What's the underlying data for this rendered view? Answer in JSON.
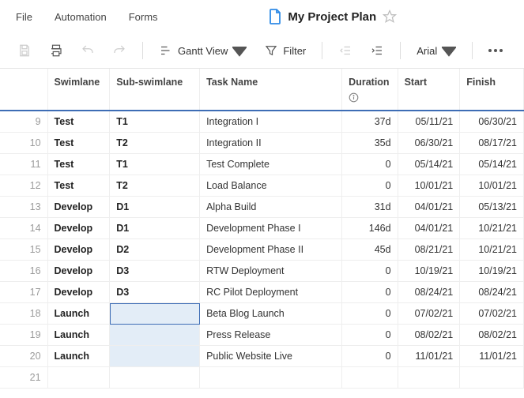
{
  "menu": {
    "file": "File",
    "automation": "Automation",
    "forms": "Forms"
  },
  "doc": {
    "title": "My Project Plan"
  },
  "toolbar": {
    "view_label": "Gantt View",
    "filter_label": "Filter",
    "font_label": "Arial"
  },
  "columns": {
    "swimlane": "Swimlane",
    "sub_swimlane": "Sub-swimlane",
    "task": "Task Name",
    "duration": "Duration",
    "start": "Start",
    "finish": "Finish"
  },
  "rows": [
    {
      "n": "9",
      "swim": "Test",
      "sub": "T1",
      "task": "Integration I",
      "dur": "37d",
      "start": "05/11/21",
      "finish": "06/30/21"
    },
    {
      "n": "10",
      "swim": "Test",
      "sub": "T2",
      "task": "Integration II",
      "dur": "35d",
      "start": "06/30/21",
      "finish": "08/17/21"
    },
    {
      "n": "11",
      "swim": "Test",
      "sub": "T1",
      "task": "Test Complete",
      "dur": "0",
      "start": "05/14/21",
      "finish": "05/14/21"
    },
    {
      "n": "12",
      "swim": "Test",
      "sub": "T2",
      "task": "Load Balance",
      "dur": "0",
      "start": "10/01/21",
      "finish": "10/01/21"
    },
    {
      "n": "13",
      "swim": "Develop",
      "sub": "D1",
      "task": "Alpha Build",
      "dur": "31d",
      "start": "04/01/21",
      "finish": "05/13/21"
    },
    {
      "n": "14",
      "swim": "Develop",
      "sub": "D1",
      "task": "Development Phase I",
      "dur": "146d",
      "start": "04/01/21",
      "finish": "10/21/21"
    },
    {
      "n": "15",
      "swim": "Develop",
      "sub": "D2",
      "task": "Development Phase II",
      "dur": "45d",
      "start": "08/21/21",
      "finish": "10/21/21"
    },
    {
      "n": "16",
      "swim": "Develop",
      "sub": "D3",
      "task": "RTW Deployment",
      "dur": "0",
      "start": "10/19/21",
      "finish": "10/19/21"
    },
    {
      "n": "17",
      "swim": "Develop",
      "sub": "D3",
      "task": "RC Pilot Deployment",
      "dur": "0",
      "start": "08/24/21",
      "finish": "08/24/21"
    },
    {
      "n": "18",
      "swim": "Launch",
      "sub": "",
      "task": "Beta Blog Launch",
      "dur": "0",
      "start": "07/02/21",
      "finish": "07/02/21"
    },
    {
      "n": "19",
      "swim": "Launch",
      "sub": "",
      "task": "Press Release",
      "dur": "0",
      "start": "08/02/21",
      "finish": "08/02/21"
    },
    {
      "n": "20",
      "swim": "Launch",
      "sub": "",
      "task": "Public Website Live",
      "dur": "0",
      "start": "11/01/21",
      "finish": "11/01/21"
    },
    {
      "n": "21",
      "swim": "",
      "sub": "",
      "task": "",
      "dur": "",
      "start": "",
      "finish": ""
    }
  ],
  "selected_row_index": 9
}
